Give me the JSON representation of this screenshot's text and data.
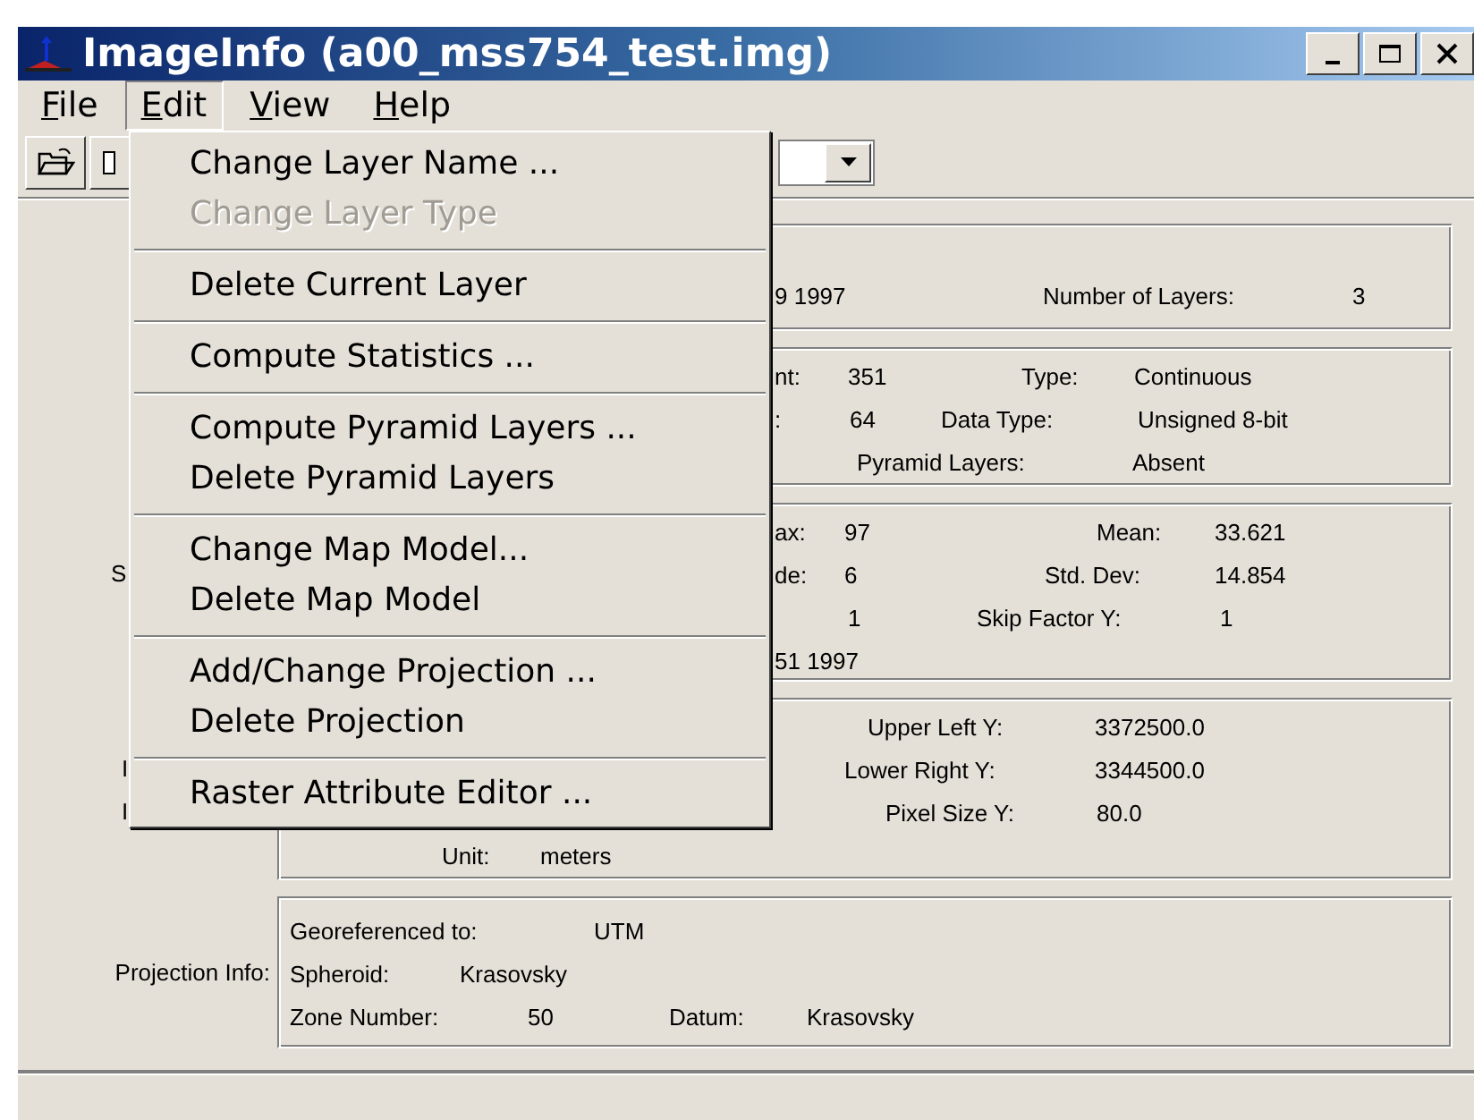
{
  "window": {
    "title": "ImageInfo (a00_mss754_test.img)"
  },
  "menu_bar": [
    {
      "label": "File",
      "selected": false
    },
    {
      "label": "Edit",
      "selected": true
    },
    {
      "label": "View",
      "selected": false
    },
    {
      "label": "Help",
      "selected": false
    }
  ],
  "edit_menu": [
    [
      {
        "label": "Change Layer Name ...",
        "disabled": false
      },
      {
        "label": "Change Layer Type",
        "disabled": true
      }
    ],
    [
      {
        "label": "Delete Current Layer",
        "disabled": false
      }
    ],
    [
      {
        "label": "Compute Statistics ...",
        "disabled": false
      }
    ],
    [
      {
        "label": "Compute Pyramid Layers ...",
        "disabled": false
      },
      {
        "label": "Delete Pyramid Layers",
        "disabled": false
      }
    ],
    [
      {
        "label": "Change Map Model...",
        "disabled": false
      },
      {
        "label": "Delete Map Model",
        "disabled": false
      }
    ],
    [
      {
        "label": "Add/Change Projection ...",
        "disabled": false
      },
      {
        "label": "Delete Projection",
        "disabled": false
      }
    ],
    [
      {
        "label": "Raster Attribute Editor ...",
        "disabled": false
      }
    ]
  ],
  "panels": [
    {
      "rows": [
        {
          "cells": [
            "9 1997",
            "Number of Layers:",
            "3"
          ]
        }
      ]
    },
    {
      "rows": [
        {
          "cells": [
            "nt:",
            "351",
            "Type:",
            "Continuous"
          ]
        },
        {
          "cells": [
            ":",
            "64",
            "Data Type:",
            "Unsigned 8-bit"
          ]
        },
        {
          "cells": [
            "",
            "",
            "Pyramid Layers:",
            "Absent"
          ]
        }
      ]
    },
    {
      "rows": [
        {
          "cells": [
            "ax:",
            "97",
            "Mean:",
            "33.621"
          ]
        },
        {
          "side_label": "S",
          "cells": [
            "de:",
            "6",
            "Std. Dev:",
            "14.854"
          ]
        },
        {
          "cells": [
            "",
            "1",
            "Skip Factor Y:",
            "1"
          ]
        },
        {
          "cells": [
            "51 1997"
          ]
        }
      ]
    },
    {
      "rows": [
        {
          "cells": [
            "Upper Left Y:",
            "3372500.0"
          ]
        },
        {
          "side_label": "I",
          "cells": [
            "Lower Right Y:",
            "3344500.0"
          ]
        },
        {
          "side_label": "I",
          "cells": [
            "Pixel Size Y:",
            "80.0"
          ]
        },
        {
          "cells": [
            "Unit:",
            "meters"
          ]
        }
      ]
    },
    {
      "rows": [
        {
          "cells": [
            "Georeferenced to:",
            "UTM"
          ]
        },
        {
          "side_label": "Projection Info:",
          "cells": [
            "Spheroid:",
            "Krasovsky"
          ]
        },
        {
          "cells": [
            "Zone Number:",
            "50",
            "Datum:",
            "Krasovsky"
          ]
        }
      ]
    }
  ]
}
